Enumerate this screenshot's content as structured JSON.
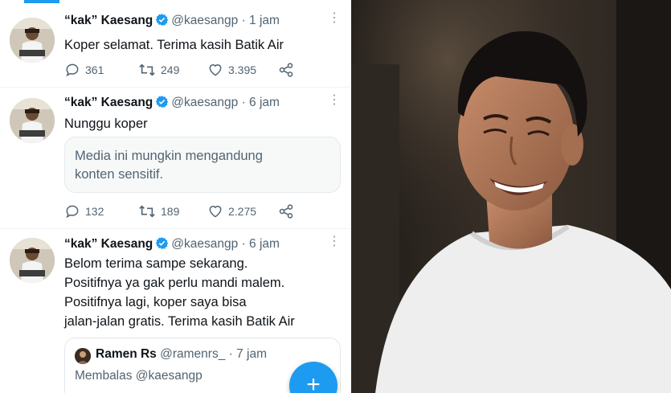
{
  "tweets": [
    {
      "name": "“kak” Kaesang",
      "handle": "@kaesangp",
      "dot": "·",
      "time": "1 jam",
      "lines": [
        "Koper selamat. Terima kasih Batik Air"
      ],
      "replies": "361",
      "retweets": "249",
      "likes": "3.395"
    },
    {
      "name": "“kak” Kaesang",
      "handle": "@kaesangp",
      "dot": "·",
      "time": "6 jam",
      "lines": [
        "Nunggu koper"
      ],
      "media_warning": [
        "Media ini mungkin mengandung",
        "konten sensitif."
      ],
      "replies": "132",
      "retweets": "189",
      "likes": "2.275"
    },
    {
      "name": "“kak” Kaesang",
      "handle": "@kaesangp",
      "dot": "·",
      "time": "6 jam",
      "lines": [
        "Belom terima sampe sekarang.",
        "Positifnya ya gak perlu mandi malem.",
        "Positifnya lagi, koper saya bisa",
        "jalan-jalan gratis. Terima kasih Batik Air"
      ],
      "quote": {
        "name": "Ramen Rs",
        "handle": "@ramenrs_",
        "dot": "·",
        "time": "7 jam",
        "reply_to": "Membalas @kaesangp"
      }
    }
  ],
  "fab_symbol": "+",
  "colors": {
    "accent": "#1d9bf0",
    "text_primary": "#0f1419",
    "text_secondary": "#536471"
  },
  "icons": {
    "verified": "verified-badge-icon",
    "reply": "reply-icon",
    "retweet": "retweet-icon",
    "like": "heart-icon",
    "share": "share-icon",
    "more": "more-icon",
    "compose": "plus-icon"
  }
}
